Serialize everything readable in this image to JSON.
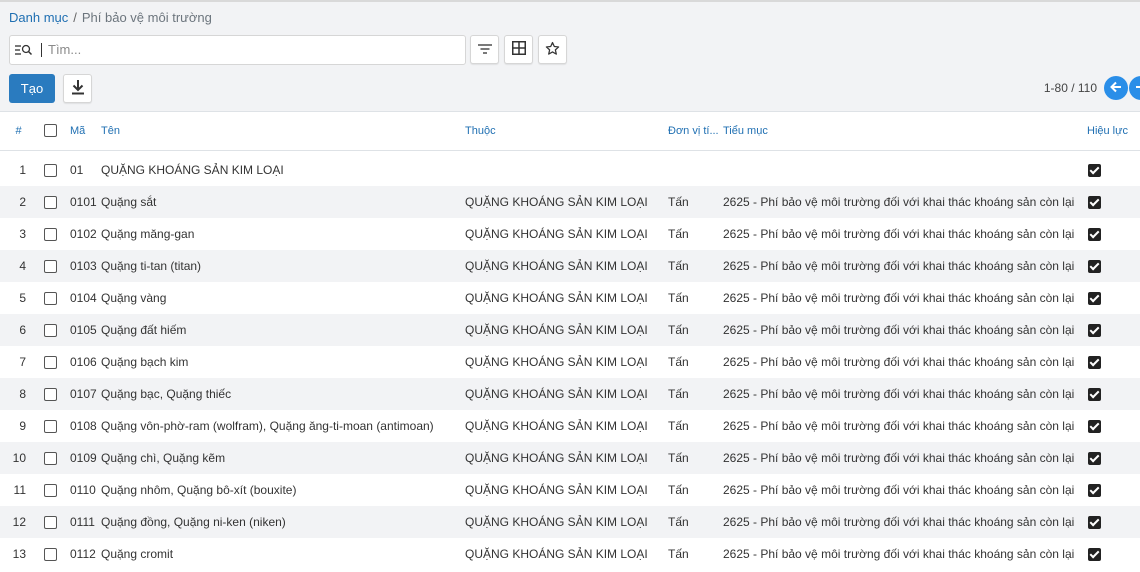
{
  "breadcrumb": {
    "parent": "Danh mục",
    "separator": "/",
    "current": "Phí bảo vệ môi trường"
  },
  "search": {
    "placeholder": "Tìm...",
    "value": ""
  },
  "toolbar": {
    "create_label": "Tạo"
  },
  "pager": {
    "value": "1-80 / 110"
  },
  "columns": {
    "num": "#",
    "code": "Mã",
    "name": "Tên",
    "parent": "Thuộc",
    "unit": "Đơn vị tí...",
    "item": "Tiểu mục",
    "active": "Hiệu lực"
  },
  "rows": [
    {
      "num": "1",
      "code": "01",
      "name": "QUẶNG KHOÁNG SẢN KIM LOẠI",
      "parent": "",
      "unit": "",
      "item": "",
      "active": true
    },
    {
      "num": "2",
      "code": "0101",
      "name": "Quặng sắt",
      "parent": "QUẶNG KHOÁNG SẢN KIM LOẠI",
      "unit": "Tấn",
      "item": "2625 - Phí bảo vệ môi trường đối với khai thác khoáng sản còn lại",
      "active": true
    },
    {
      "num": "3",
      "code": "0102",
      "name": "Quặng măng-gan",
      "parent": "QUẶNG KHOÁNG SẢN KIM LOẠI",
      "unit": "Tấn",
      "item": "2625 - Phí bảo vệ môi trường đối với khai thác khoáng sản còn lại",
      "active": true
    },
    {
      "num": "4",
      "code": "0103",
      "name": "Quặng ti-tan (titan)",
      "parent": "QUẶNG KHOÁNG SẢN KIM LOẠI",
      "unit": "Tấn",
      "item": "2625 - Phí bảo vệ môi trường đối với khai thác khoáng sản còn lại",
      "active": true
    },
    {
      "num": "5",
      "code": "0104",
      "name": "Quặng vàng",
      "parent": "QUẶNG KHOÁNG SẢN KIM LOẠI",
      "unit": "Tấn",
      "item": "2625 - Phí bảo vệ môi trường đối với khai thác khoáng sản còn lại",
      "active": true
    },
    {
      "num": "6",
      "code": "0105",
      "name": "Quặng đất hiếm",
      "parent": "QUẶNG KHOÁNG SẢN KIM LOẠI",
      "unit": "Tấn",
      "item": "2625 - Phí bảo vệ môi trường đối với khai thác khoáng sản còn lại",
      "active": true
    },
    {
      "num": "7",
      "code": "0106",
      "name": "Quặng bạch kim",
      "parent": "QUẶNG KHOÁNG SẢN KIM LOẠI",
      "unit": "Tấn",
      "item": "2625 - Phí bảo vệ môi trường đối với khai thác khoáng sản còn lại",
      "active": true
    },
    {
      "num": "8",
      "code": "0107",
      "name": "Quặng bạc, Quặng thiếc",
      "parent": "QUẶNG KHOÁNG SẢN KIM LOẠI",
      "unit": "Tấn",
      "item": "2625 - Phí bảo vệ môi trường đối với khai thác khoáng sản còn lại",
      "active": true
    },
    {
      "num": "9",
      "code": "0108",
      "name": "Quặng vôn-phờ-ram (wolfram), Quặng ăng-ti-moan (antimoan)",
      "parent": "QUẶNG KHOÁNG SẢN KIM LOẠI",
      "unit": "Tấn",
      "item": "2625 - Phí bảo vệ môi trường đối với khai thác khoáng sản còn lại",
      "active": true
    },
    {
      "num": "10",
      "code": "0109",
      "name": "Quặng chì, Quặng kẽm",
      "parent": "QUẶNG KHOÁNG SẢN KIM LOẠI",
      "unit": "Tấn",
      "item": "2625 - Phí bảo vệ môi trường đối với khai thác khoáng sản còn lại",
      "active": true
    },
    {
      "num": "11",
      "code": "0110",
      "name": "Quặng nhôm, Quặng bô-xít (bouxite)",
      "parent": "QUẶNG KHOÁNG SẢN KIM LOẠI",
      "unit": "Tấn",
      "item": "2625 - Phí bảo vệ môi trường đối với khai thác khoáng sản còn lại",
      "active": true
    },
    {
      "num": "12",
      "code": "0111",
      "name": "Quặng đồng, Quặng ni-ken (niken)",
      "parent": "QUẶNG KHOÁNG SẢN KIM LOẠI",
      "unit": "Tấn",
      "item": "2625 - Phí bảo vệ môi trường đối với khai thác khoáng sản còn lại",
      "active": true
    },
    {
      "num": "13",
      "code": "0112",
      "name": "Quặng cromit",
      "parent": "QUẶNG KHOÁNG SẢN KIM LOẠI",
      "unit": "Tấn",
      "item": "2625 - Phí bảo vệ môi trường đối với khai thác khoáng sản còn lại",
      "active": true
    }
  ],
  "icons": {
    "search": "search-filter-icon",
    "filter": "filter-lines-icon",
    "grid": "grid-icon",
    "star": "star-icon",
    "download": "download-icon",
    "prev": "arrow-left-icon",
    "next": "arrow-right-icon"
  },
  "colors": {
    "accent": "#2a7bbf",
    "link": "#1f6fb2",
    "pager": "#2a8ee8",
    "panel_bg": "#f2f3f5",
    "row_alt": "#f2f3f5"
  }
}
